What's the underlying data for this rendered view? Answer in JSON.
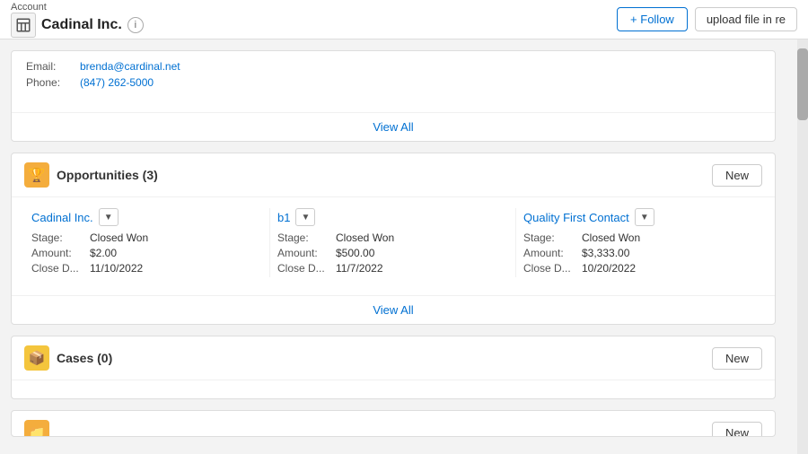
{
  "header": {
    "breadcrumb": "Account",
    "account_name": "Cadinal Inc.",
    "follow_label": "+ Follow",
    "upload_label": "upload file in re",
    "info_icon_label": "i"
  },
  "contact": {
    "email_label": "Email:",
    "email_value": "brenda@cardinal.net",
    "phone_label": "Phone:",
    "phone_value": "(847) 262-5000",
    "view_all_label": "View All"
  },
  "opportunities": {
    "title": "Opportunities (3)",
    "new_label": "New",
    "view_all_label": "View All",
    "items": [
      {
        "name": "Cadinal Inc.",
        "stage_label": "Stage:",
        "stage_value": "Closed Won",
        "amount_label": "Amount:",
        "amount_value": "$2.00",
        "close_label": "Close D...",
        "close_value": "11/10/2022"
      },
      {
        "name": "b1",
        "stage_label": "Stage:",
        "stage_value": "Closed Won",
        "amount_label": "Amount:",
        "amount_value": "$500.00",
        "close_label": "Close D...",
        "close_value": "11/7/2022"
      },
      {
        "name": "Quality First Contact",
        "stage_label": "Stage:",
        "stage_value": "Closed Won",
        "amount_label": "Amount:",
        "amount_value": "$3,333.00",
        "close_label": "Close D...",
        "close_value": "10/20/2022"
      }
    ]
  },
  "cases": {
    "title": "Cases (0)",
    "new_label": "New"
  },
  "bottom_section": {
    "new_label": "New"
  },
  "icons": {
    "account_building": "🏢",
    "opportunities_trophy": "🏆",
    "cases_box": "📦",
    "bottom_icon": "📁"
  }
}
